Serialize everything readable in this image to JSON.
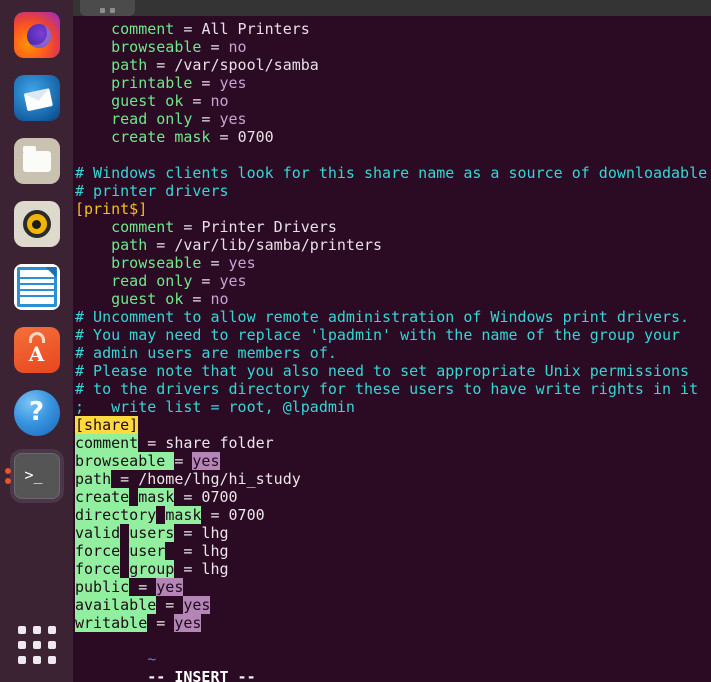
{
  "window": {
    "titlebar": {
      "tab_label": ""
    }
  },
  "dock": {
    "items": [
      {
        "name": "firefox",
        "label": "Firefox Web Browser",
        "running": false
      },
      {
        "name": "thunderbird",
        "label": "Thunderbird Mail",
        "running": false
      },
      {
        "name": "files",
        "label": "Files",
        "running": false
      },
      {
        "name": "rhythmbox",
        "label": "Rhythmbox",
        "running": false
      },
      {
        "name": "libreoffice",
        "label": "LibreOffice Writer",
        "running": false
      },
      {
        "name": "ubuntu-software",
        "label": "Ubuntu Software",
        "running": false,
        "letter": "A"
      },
      {
        "name": "help",
        "label": "Help",
        "running": false,
        "glyph": "?"
      },
      {
        "name": "terminal",
        "label": "Terminal",
        "running": true,
        "glyph": ">_",
        "window_count": 2
      }
    ],
    "show_applications_label": "Show Applications"
  },
  "terminal": {
    "status_line": "-- INSERT --",
    "tilde": "~",
    "lines": [
      {
        "indent": "    ",
        "segments": [
          {
            "t": "comment",
            "c": "k"
          },
          {
            "t": " = ",
            "c": "p"
          },
          {
            "t": "All Printers",
            "c": "p"
          }
        ]
      },
      {
        "indent": "    ",
        "segments": [
          {
            "t": "browseable",
            "c": "k"
          },
          {
            "t": " = ",
            "c": "p"
          },
          {
            "t": "no",
            "c": "v"
          }
        ]
      },
      {
        "indent": "    ",
        "segments": [
          {
            "t": "path",
            "c": "k"
          },
          {
            "t": " = ",
            "c": "p"
          },
          {
            "t": "/var/spool/samba",
            "c": "p"
          }
        ]
      },
      {
        "indent": "    ",
        "segments": [
          {
            "t": "printable",
            "c": "k"
          },
          {
            "t": " = ",
            "c": "p"
          },
          {
            "t": "yes",
            "c": "v"
          }
        ]
      },
      {
        "indent": "    ",
        "segments": [
          {
            "t": "guest ok",
            "c": "k"
          },
          {
            "t": " = ",
            "c": "p"
          },
          {
            "t": "no",
            "c": "v"
          }
        ]
      },
      {
        "indent": "    ",
        "segments": [
          {
            "t": "read only",
            "c": "k"
          },
          {
            "t": " = ",
            "c": "p"
          },
          {
            "t": "yes",
            "c": "v"
          }
        ]
      },
      {
        "indent": "    ",
        "segments": [
          {
            "t": "create mask",
            "c": "k"
          },
          {
            "t": " = ",
            "c": "p"
          },
          {
            "t": "0700",
            "c": "p"
          }
        ]
      },
      {
        "indent": "",
        "segments": []
      },
      {
        "indent": "",
        "segments": [
          {
            "t": "# Windows clients look for this share name as a source of downloadable",
            "c": "c"
          }
        ]
      },
      {
        "indent": "",
        "segments": [
          {
            "t": "# printer drivers",
            "c": "c"
          }
        ]
      },
      {
        "indent": "",
        "segments": [
          {
            "t": "[print$]",
            "c": "s"
          }
        ]
      },
      {
        "indent": "    ",
        "segments": [
          {
            "t": "comment",
            "c": "k"
          },
          {
            "t": " = ",
            "c": "p"
          },
          {
            "t": "Printer Drivers",
            "c": "p"
          }
        ]
      },
      {
        "indent": "    ",
        "segments": [
          {
            "t": "path",
            "c": "k"
          },
          {
            "t": " = ",
            "c": "p"
          },
          {
            "t": "/var/lib/samba/printers",
            "c": "p"
          }
        ]
      },
      {
        "indent": "    ",
        "segments": [
          {
            "t": "browseable",
            "c": "k"
          },
          {
            "t": " = ",
            "c": "p"
          },
          {
            "t": "yes",
            "c": "v"
          }
        ]
      },
      {
        "indent": "    ",
        "segments": [
          {
            "t": "read only",
            "c": "k"
          },
          {
            "t": " = ",
            "c": "p"
          },
          {
            "t": "yes",
            "c": "v"
          }
        ]
      },
      {
        "indent": "    ",
        "segments": [
          {
            "t": "guest ok",
            "c": "k"
          },
          {
            "t": " = ",
            "c": "p"
          },
          {
            "t": "no",
            "c": "v"
          }
        ]
      },
      {
        "indent": "",
        "segments": [
          {
            "t": "# Uncomment to allow remote administration of Windows print drivers.",
            "c": "c"
          }
        ]
      },
      {
        "indent": "",
        "segments": [
          {
            "t": "# You may need to replace 'lpadmin' with the name of the group your",
            "c": "c"
          }
        ]
      },
      {
        "indent": "",
        "segments": [
          {
            "t": "# admin users are members of.",
            "c": "c"
          }
        ]
      },
      {
        "indent": "",
        "segments": [
          {
            "t": "# Please note that you also need to set appropriate Unix permissions",
            "c": "c"
          }
        ]
      },
      {
        "indent": "",
        "segments": [
          {
            "t": "# to the drivers directory for these users to have write rights in it",
            "c": "c"
          }
        ]
      },
      {
        "indent": "",
        "segments": [
          {
            "t": ";   write list = root, @lpadmin",
            "c": "c"
          }
        ]
      },
      {
        "indent": "",
        "segments": [
          {
            "t": "[share]",
            "c": "hy"
          }
        ]
      },
      {
        "indent": "",
        "segments": [
          {
            "t": "comment",
            "c": "hg"
          },
          {
            "t": " = share folder",
            "c": "hw"
          }
        ]
      },
      {
        "indent": "",
        "segments": [
          {
            "t": "browseable",
            "c": "hg"
          },
          {
            "t": " ",
            "c": "hg"
          },
          {
            "t": "= ",
            "c": "hw"
          },
          {
            "t": "yes",
            "c": "hp"
          }
        ]
      },
      {
        "indent": "",
        "segments": [
          {
            "t": "path",
            "c": "hg"
          },
          {
            "t": " ",
            "c": "hw"
          },
          {
            "t": "= /home/lhg/hi_study",
            "c": "hw"
          }
        ]
      },
      {
        "indent": "",
        "segments": [
          {
            "t": "create",
            "c": "hg"
          },
          {
            "t": " ",
            "c": "hw"
          },
          {
            "t": "mask",
            "c": "hg"
          },
          {
            "t": " = 0700",
            "c": "hw"
          }
        ]
      },
      {
        "indent": "",
        "segments": [
          {
            "t": "directory",
            "c": "hg"
          },
          {
            "t": " ",
            "c": "hw"
          },
          {
            "t": "mask",
            "c": "hg"
          },
          {
            "t": " = 0700",
            "c": "hw"
          }
        ]
      },
      {
        "indent": "",
        "segments": [
          {
            "t": "valid",
            "c": "hg"
          },
          {
            "t": " ",
            "c": "hw"
          },
          {
            "t": "users",
            "c": "hg"
          },
          {
            "t": " = lhg",
            "c": "hw"
          }
        ]
      },
      {
        "indent": "",
        "segments": [
          {
            "t": "force",
            "c": "hg"
          },
          {
            "t": " ",
            "c": "hw"
          },
          {
            "t": "user",
            "c": "hg"
          },
          {
            "t": "  = lhg",
            "c": "hw"
          }
        ]
      },
      {
        "indent": "",
        "segments": [
          {
            "t": "force",
            "c": "hg"
          },
          {
            "t": " ",
            "c": "hw"
          },
          {
            "t": "group",
            "c": "hg"
          },
          {
            "t": " = lhg",
            "c": "hw"
          }
        ]
      },
      {
        "indent": "",
        "segments": [
          {
            "t": "public",
            "c": "hg"
          },
          {
            "t": " = ",
            "c": "hw"
          },
          {
            "t": "yes",
            "c": "hp"
          }
        ]
      },
      {
        "indent": "",
        "segments": [
          {
            "t": "available",
            "c": "hg"
          },
          {
            "t": " = ",
            "c": "hw"
          },
          {
            "t": "yes",
            "c": "hp"
          }
        ]
      },
      {
        "indent": "",
        "segments": [
          {
            "t": "writable",
            "c": "hg"
          },
          {
            "t": " = ",
            "c": "hw"
          },
          {
            "t": "yes",
            "c": "hp"
          }
        ]
      }
    ]
  },
  "colors": {
    "terminal_bg": "#2b0a23",
    "dock_bg": "#3b2334",
    "titlebar_bg": "#343434",
    "key_green": "#6ee88a",
    "value_purple": "#c9a2d4",
    "comment_cyan": "#34d6d6",
    "section_yellow": "#f0c419",
    "highlight_green": "#91ef9f",
    "highlight_purple": "#b585b7",
    "highlight_yellow": "#ffd93d"
  }
}
